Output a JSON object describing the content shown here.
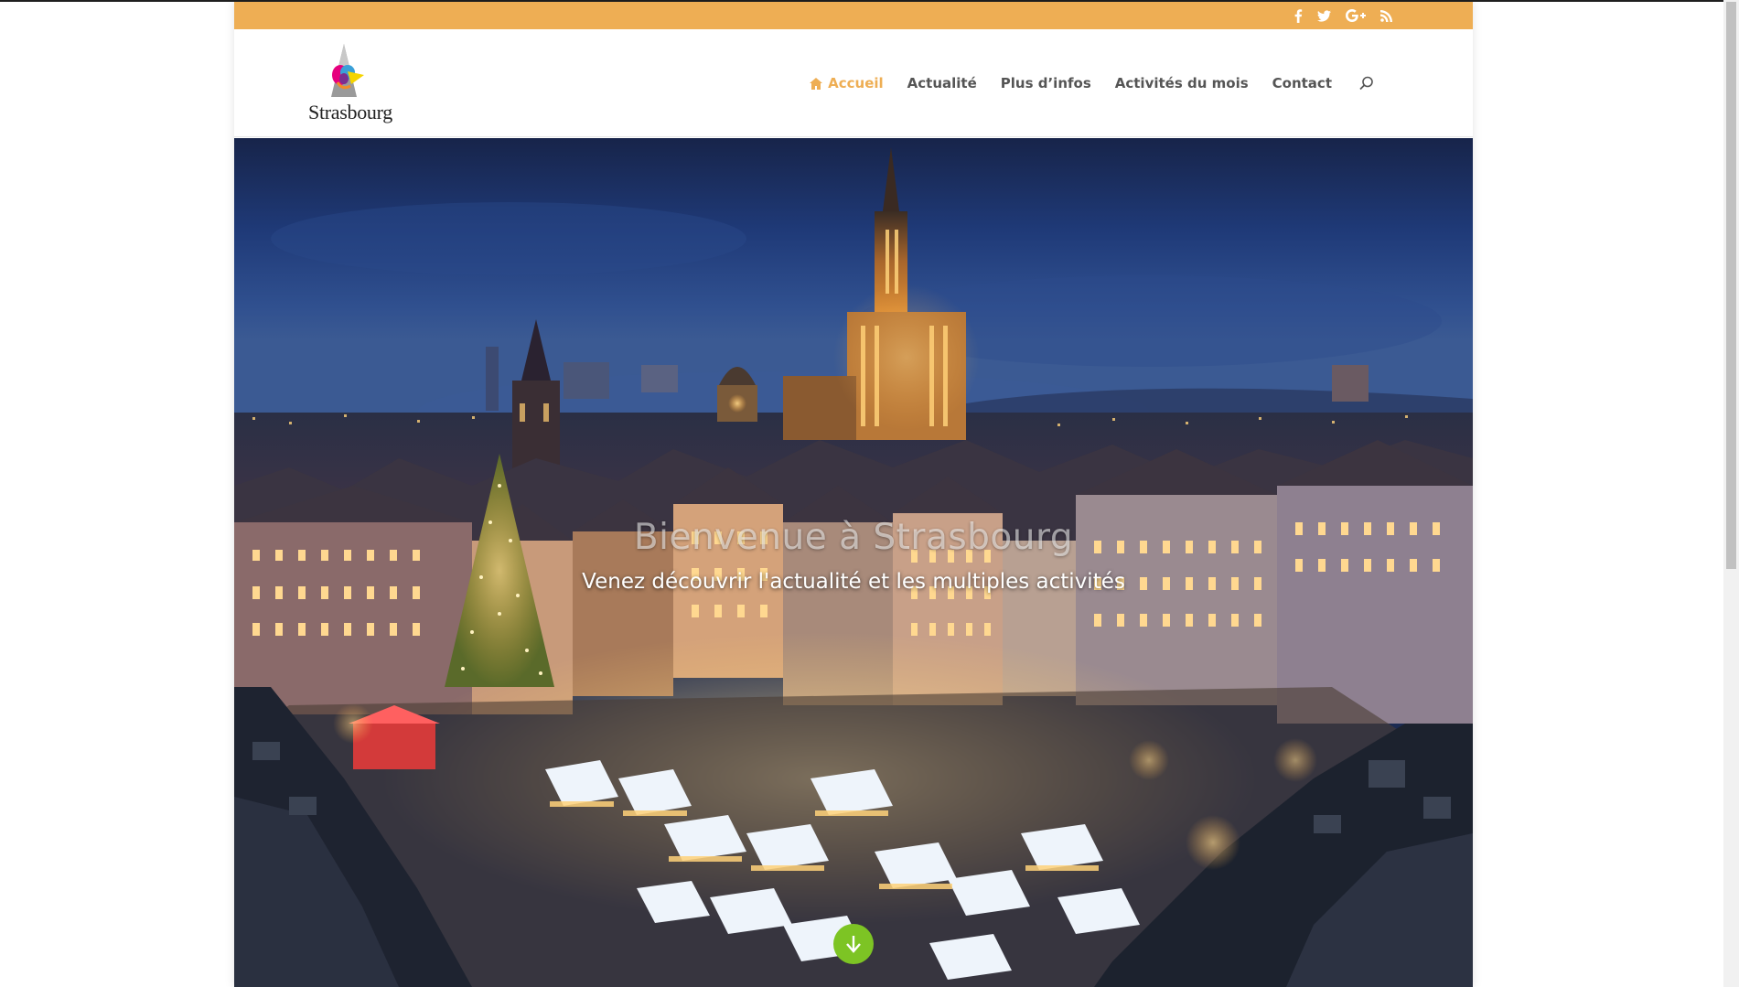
{
  "colors": {
    "accent": "#eeae54",
    "nav_text": "#555555",
    "scroll_button": "#7dc424"
  },
  "topbar": {
    "social_icons": [
      "facebook-icon",
      "twitter-icon",
      "google-plus-icon",
      "rss-icon"
    ]
  },
  "header": {
    "logo_text": "Strasbourg",
    "nav": {
      "items": [
        {
          "label": "Accueil",
          "icon": "home-icon",
          "active": true
        },
        {
          "label": "Actualité",
          "active": false
        },
        {
          "label": "Plus d’infos",
          "active": false
        },
        {
          "label": "Activités du mois",
          "active": false
        },
        {
          "label": "Contact",
          "active": false
        }
      ],
      "search_icon": "search-icon"
    }
  },
  "hero": {
    "title": "Bienvenue à Strasbourg",
    "subtitle": "Venez découvrir l'actualité et les multiples activités",
    "scroll_icon": "arrow-down-icon"
  }
}
